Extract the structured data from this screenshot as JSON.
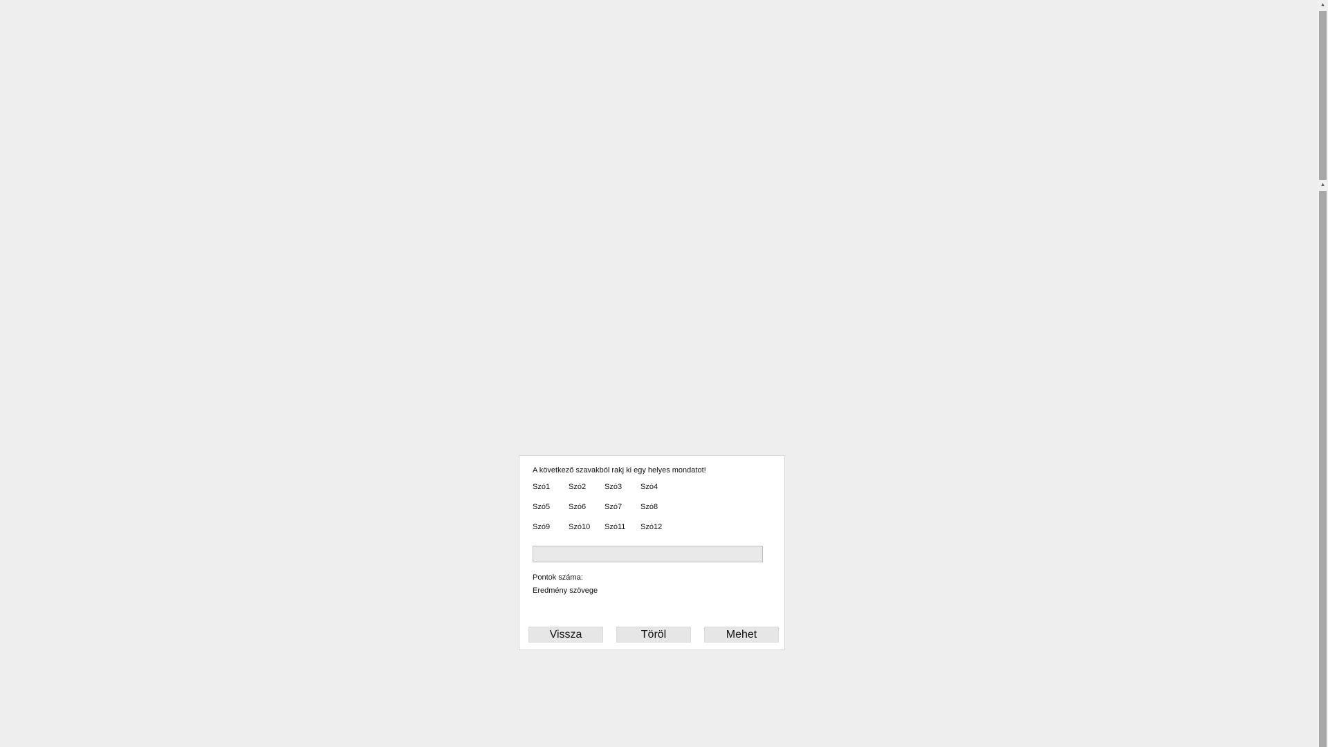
{
  "dialog": {
    "instruction": "A következő szavakból rakj ki egy helyes mondatot!",
    "words": [
      "Szó1",
      "Szó2",
      "Szó3",
      "Szó4",
      "Szó5",
      "Szó6",
      "Szó7",
      "Szó8",
      "Szó9",
      "Szó10",
      "Szó11",
      "Szó12"
    ],
    "answer_value": "",
    "score_label": "Pontok száma:",
    "result_text": "Eredmény szövege",
    "buttons": {
      "back": "Vissza",
      "clear": "Töröl",
      "go": "Mehet"
    }
  },
  "colors": {
    "page_background": "#eeeeee",
    "dialog_background": "#ffffff",
    "button_background": "#e6e6e6",
    "input_background": "#e9e9e9"
  },
  "icons": {
    "scroll_up": "arrow-up-icon"
  }
}
